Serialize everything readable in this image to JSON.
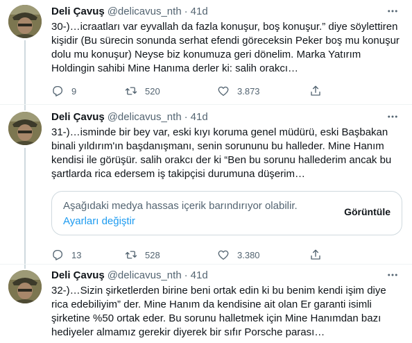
{
  "tweets": [
    {
      "name": "Deli Çavuş",
      "handle": "@delicavus_nth",
      "separator": "·",
      "time": "41d",
      "lines": [
        "30-)…icraatları var eyvallah da fazla konuşur, boş konuşur.” diye söylettiren",
        "kişidir (Bu sürecin sonunda serhat efendi göreceksin Peker boş mu konuşur",
        "dolu mu konuşur) Neyse biz konumuza geri dönelim. Marka Yatırım",
        "Holdingin sahibi Mine Hanıma derler ki: salih orakcı…"
      ],
      "replies": "9",
      "retweets": "520",
      "likes": "3.873"
    },
    {
      "name": "Deli Çavuş",
      "handle": "@delicavus_nth",
      "separator": "·",
      "time": "41d",
      "lines": [
        "31-)…isminde bir bey var, eski kıyı koruma genel müdürü, eski Başbakan",
        "binali yıldırım'ın başdanışmanı, senin sorununu bu halleder. Mine Hanım",
        "kendisi ile görüşür. salih orakcı der ki “Ben bu sorunu hallederim ancak bu",
        "şartlarda rica edersem iş takipçisi durumuna düşerim…"
      ],
      "sensitive_notice": "Aşağıdaki medya hassas içerik barındırıyor olabilir.",
      "settings_link": "Ayarları değiştir",
      "view_button": "Görüntüle",
      "replies": "13",
      "retweets": "528",
      "likes": "3.380"
    },
    {
      "name": "Deli Çavuş",
      "handle": "@delicavus_nth",
      "separator": "·",
      "time": "41d",
      "lines": [
        "32-)…Sizin şirketlerden birine beni ortak edin ki bu benim kendi işim diye",
        "rica edebiliyim” der. Mine Hanım da kendisine ait olan Er garanti isimli",
        "şirketine %50 ortak eder. Bu sorunu halletmek için Mine Hanımdan bazı",
        "hediyeler almamız gerekir diyerek bir sıfır Porsche parası…"
      ]
    }
  ],
  "icons": {
    "more": "more-horizontal-icon",
    "reply": "reply-icon",
    "retweet": "retweet-icon",
    "like": "heart-icon",
    "share": "share-icon"
  },
  "colors": {
    "text": "#0f1419",
    "secondary": "#536471",
    "link": "#1d9bf0",
    "border": "#cfd9de",
    "divider": "#eff3f4"
  }
}
